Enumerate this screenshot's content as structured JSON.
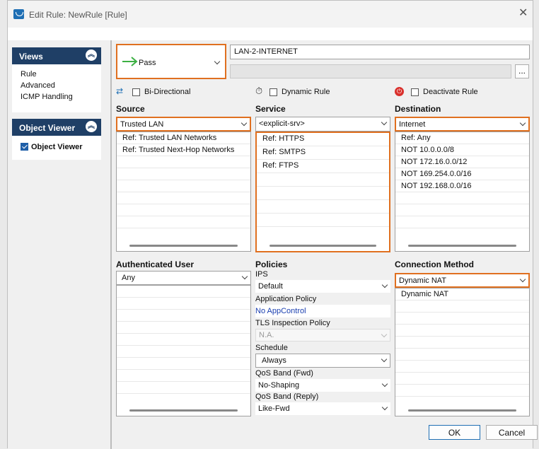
{
  "window": {
    "title": "Edit Rule: NewRule [Rule]"
  },
  "sidebar": {
    "views": {
      "header": "Views",
      "items": [
        "Rule",
        "Advanced",
        "ICMP Handling"
      ]
    },
    "object_viewer": {
      "header": "Object Viewer",
      "item": "Object Viewer",
      "checked": true
    }
  },
  "rule": {
    "action": "Pass",
    "name": "LAN-2-INTERNET",
    "description": "",
    "more_button": "...",
    "bi_directional": "Bi-Directional",
    "dynamic_rule": "Dynamic Rule",
    "deactivate_rule": "Deactivate Rule"
  },
  "source": {
    "label": "Source",
    "selected": "Trusted LAN",
    "items": [
      "Ref: Trusted LAN Networks",
      "Ref: Trusted Next-Hop Networks"
    ]
  },
  "service": {
    "label": "Service",
    "selected": "<explicit-srv>",
    "items": [
      "Ref: HTTPS",
      "Ref: SMTPS",
      "Ref: FTPS"
    ]
  },
  "destination": {
    "label": "Destination",
    "selected": "Internet",
    "items": [
      "Ref: Any",
      "NOT 10.0.0.0/8",
      "NOT 172.16.0.0/12",
      "NOT 169.254.0.0/16",
      "NOT 192.168.0.0/16"
    ]
  },
  "auth_user": {
    "label": "Authenticated User",
    "selected": "Any"
  },
  "policies": {
    "label": "Policies",
    "ips_label": "IPS",
    "ips_value": "Default",
    "app_policy_label": "Application Policy",
    "app_policy_value": "No AppControl",
    "tls_label": "TLS Inspection Policy",
    "tls_value": "N.A.",
    "schedule_label": "Schedule",
    "schedule_value": "Always",
    "qos_fwd_label": "QoS Band (Fwd)",
    "qos_fwd_value": "No-Shaping",
    "qos_reply_label": "QoS Band (Reply)",
    "qos_reply_value": "Like-Fwd"
  },
  "connection": {
    "label": "Connection Method",
    "selected": "Dynamic NAT",
    "items": [
      "Dynamic NAT"
    ]
  },
  "buttons": {
    "ok": "OK",
    "cancel": "Cancel"
  },
  "colors": {
    "accent_orange": "#e07020",
    "header_navy": "#1f3f66",
    "pass_green": "#3cb043",
    "deactivate_red": "#d9302c"
  }
}
